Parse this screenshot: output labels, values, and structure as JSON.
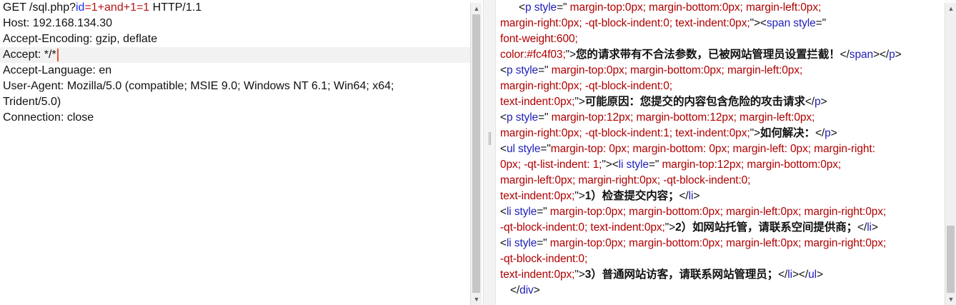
{
  "request": {
    "lines": [
      {
        "parts": [
          {
            "t": "GET /sql.php?",
            "c": ""
          },
          {
            "t": "id",
            "c": "p-blue"
          },
          {
            "t": "=1+and+1=1",
            "c": "p-red"
          },
          {
            "t": " HTTP/1.1",
            "c": ""
          }
        ]
      },
      {
        "parts": [
          {
            "t": "Host: 192.168.134.30",
            "c": ""
          }
        ]
      },
      {
        "parts": [
          {
            "t": "Accept-Encoding: gzip, deflate",
            "c": ""
          }
        ]
      },
      {
        "parts": [
          {
            "t": "Accept: */*",
            "c": ""
          }
        ],
        "current": true
      },
      {
        "parts": [
          {
            "t": "Accept-Language: en",
            "c": ""
          }
        ]
      },
      {
        "parts": [
          {
            "t": "User-Agent: Mozilla/5.0 (compatible; MSIE 9.0; Windows NT 6.1; Win64; x64;",
            "c": ""
          }
        ]
      },
      {
        "parts": [
          {
            "t": "Trident/5.0)",
            "c": ""
          }
        ]
      },
      {
        "parts": [
          {
            "t": "Connection: close",
            "c": ""
          }
        ]
      }
    ]
  },
  "response": {
    "lines": [
      {
        "indent": "ind1",
        "parts": [
          {
            "t": "<",
            "c": "punc"
          },
          {
            "t": "p",
            "c": "tag"
          },
          {
            "t": " style",
            "c": "attr"
          },
          {
            "t": "=\"",
            "c": "punc"
          },
          {
            "t": " margin-top:0px; margin-bottom:0px; margin-left:0px;",
            "c": "val"
          }
        ]
      },
      {
        "parts": [
          {
            "t": "margin-right:0px; -qt-block-indent:0; text-indent:0px;",
            "c": "val"
          },
          {
            "t": "\"><",
            "c": "punc"
          },
          {
            "t": "span",
            "c": "tag"
          },
          {
            "t": " style",
            "c": "attr"
          },
          {
            "t": "=\"",
            "c": "punc"
          }
        ]
      },
      {
        "parts": [
          {
            "t": "font-weight:600;",
            "c": "val"
          }
        ]
      },
      {
        "parts": [
          {
            "t": "color:#fc4f03;",
            "c": "val"
          },
          {
            "t": "\">",
            "c": "punc"
          },
          {
            "t": "您的请求带有不合法参数，已被网站管理员设置拦截！",
            "c": "txt"
          },
          {
            "t": "</",
            "c": "punc"
          },
          {
            "t": "span",
            "c": "tag"
          },
          {
            "t": "></",
            "c": "punc"
          },
          {
            "t": "p",
            "c": "tag"
          },
          {
            "t": ">",
            "c": "punc"
          }
        ]
      },
      {
        "parts": [
          {
            "t": "<",
            "c": "punc"
          },
          {
            "t": "p",
            "c": "tag"
          },
          {
            "t": " style",
            "c": "attr"
          },
          {
            "t": "=\"",
            "c": "punc"
          },
          {
            "t": " margin-top:0px; margin-bottom:0px; margin-left:0px;",
            "c": "val"
          }
        ]
      },
      {
        "parts": [
          {
            "t": "margin-right:0px; -qt-block-indent:0;",
            "c": "val"
          }
        ]
      },
      {
        "parts": [
          {
            "t": "text-indent:0px;",
            "c": "val"
          },
          {
            "t": "\">",
            "c": "punc"
          },
          {
            "t": "可能原因：您提交的内容包含危险的攻击请求",
            "c": "txt"
          },
          {
            "t": "</",
            "c": "punc"
          },
          {
            "t": "p",
            "c": "tag"
          },
          {
            "t": ">",
            "c": "punc"
          }
        ]
      },
      {
        "parts": [
          {
            "t": "<",
            "c": "punc"
          },
          {
            "t": "p",
            "c": "tag"
          },
          {
            "t": " style",
            "c": "attr"
          },
          {
            "t": "=\"",
            "c": "punc"
          },
          {
            "t": " margin-top:12px; margin-bottom:12px; margin-left:0px;",
            "c": "val"
          }
        ]
      },
      {
        "parts": [
          {
            "t": "margin-right:0px; -qt-block-indent:1; text-indent:0px;",
            "c": "val"
          },
          {
            "t": "\">",
            "c": "punc"
          },
          {
            "t": "如何解决：",
            "c": "txt"
          },
          {
            "t": "</",
            "c": "punc"
          },
          {
            "t": "p",
            "c": "tag"
          },
          {
            "t": ">",
            "c": "punc"
          }
        ]
      },
      {
        "parts": [
          {
            "t": "<",
            "c": "punc"
          },
          {
            "t": "ul",
            "c": "tag"
          },
          {
            "t": " style",
            "c": "attr"
          },
          {
            "t": "=\"",
            "c": "punc"
          },
          {
            "t": "margin-top: 0px; margin-bottom: 0px; margin-left: 0px; margin-right:",
            "c": "val"
          }
        ]
      },
      {
        "parts": [
          {
            "t": "0px; -qt-list-indent: 1;",
            "c": "val"
          },
          {
            "t": "\"><",
            "c": "punc"
          },
          {
            "t": "li",
            "c": "tag"
          },
          {
            "t": " style",
            "c": "attr"
          },
          {
            "t": "=\"",
            "c": "punc"
          },
          {
            "t": " margin-top:12px; margin-bottom:0px;",
            "c": "val"
          }
        ]
      },
      {
        "parts": [
          {
            "t": "margin-left:0px; margin-right:0px; -qt-block-indent:0;",
            "c": "val"
          }
        ]
      },
      {
        "parts": [
          {
            "t": "text-indent:0px;",
            "c": "val"
          },
          {
            "t": "\">",
            "c": "punc"
          },
          {
            "t": "1）检查提交内容；",
            "c": "txt"
          },
          {
            "t": "</",
            "c": "punc"
          },
          {
            "t": "li",
            "c": "tag"
          },
          {
            "t": ">",
            "c": "punc"
          }
        ]
      },
      {
        "parts": [
          {
            "t": "<",
            "c": "punc"
          },
          {
            "t": "li",
            "c": "tag"
          },
          {
            "t": " style",
            "c": "attr"
          },
          {
            "t": "=\"",
            "c": "punc"
          },
          {
            "t": " margin-top:0px; margin-bottom:0px; margin-left:0px; margin-right:0px;",
            "c": "val"
          }
        ]
      },
      {
        "parts": [
          {
            "t": "-qt-block-indent:0; text-indent:0px;",
            "c": "val"
          },
          {
            "t": "\">",
            "c": "punc"
          },
          {
            "t": "2）如网站托管，请联系空间提供商；",
            "c": "txt"
          },
          {
            "t": "</",
            "c": "punc"
          },
          {
            "t": "li",
            "c": "tag"
          },
          {
            "t": ">",
            "c": "punc"
          }
        ]
      },
      {
        "parts": [
          {
            "t": "<",
            "c": "punc"
          },
          {
            "t": "li",
            "c": "tag"
          },
          {
            "t": " style",
            "c": "attr"
          },
          {
            "t": "=\"",
            "c": "punc"
          },
          {
            "t": " margin-top:0px; margin-bottom:0px; margin-left:0px; margin-right:0px;",
            "c": "val"
          }
        ]
      },
      {
        "parts": [
          {
            "t": "-qt-block-indent:0;",
            "c": "val"
          }
        ]
      },
      {
        "parts": [
          {
            "t": "text-indent:0px;",
            "c": "val"
          },
          {
            "t": "\">",
            "c": "punc"
          },
          {
            "t": "3）普通网站访客，请联系网站管理员；",
            "c": "txt"
          },
          {
            "t": "</",
            "c": "punc"
          },
          {
            "t": "li",
            "c": "tag"
          },
          {
            "t": "></",
            "c": "punc"
          },
          {
            "t": "ul",
            "c": "tag"
          },
          {
            "t": ">",
            "c": "punc"
          }
        ]
      },
      {
        "indent": "ind2",
        "parts": [
          {
            "t": "</",
            "c": "punc"
          },
          {
            "t": "div",
            "c": "tag"
          },
          {
            "t": ">",
            "c": "punc"
          }
        ]
      }
    ]
  },
  "colors": {
    "caret": "#e8552a",
    "tag": "#1f1fb8",
    "value": "#b00000"
  }
}
